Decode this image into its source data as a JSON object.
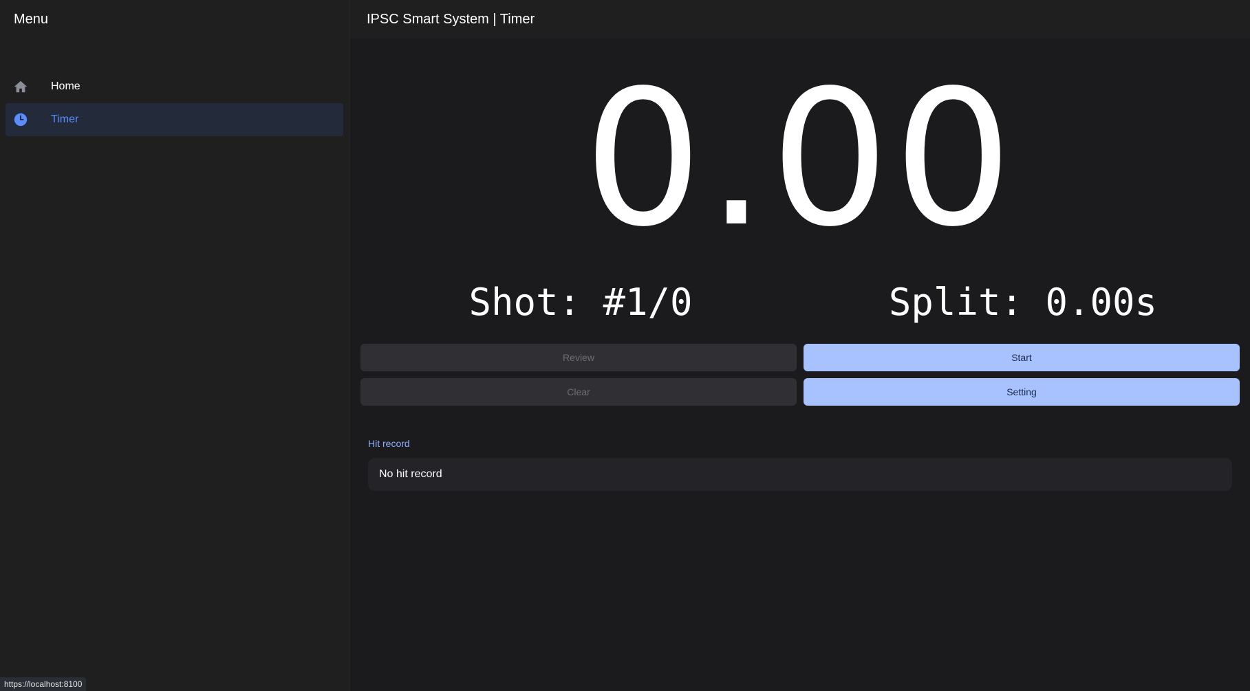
{
  "sidebar": {
    "title": "Menu",
    "items": [
      {
        "label": "Home",
        "icon": "home-icon",
        "active": false
      },
      {
        "label": "Timer",
        "icon": "clock-icon",
        "active": true
      }
    ]
  },
  "header": {
    "title": "IPSC Smart System | Timer"
  },
  "timer": {
    "display": "0.00",
    "shot": "Shot: #1/0",
    "split": "Split: 0.00s"
  },
  "buttons": {
    "review": "Review",
    "start": "Start",
    "clear": "Clear",
    "setting": "Setting"
  },
  "hit_record": {
    "label": "Hit record",
    "empty_text": "No hit record"
  },
  "status_bar": {
    "url": "https://localhost:8100"
  },
  "colors": {
    "accent": "#5a8dff",
    "primary_button": "#a8c2ff",
    "disabled_button": "#303034",
    "background": "#1b1b1e",
    "sidebar": "#1f1f1f"
  }
}
